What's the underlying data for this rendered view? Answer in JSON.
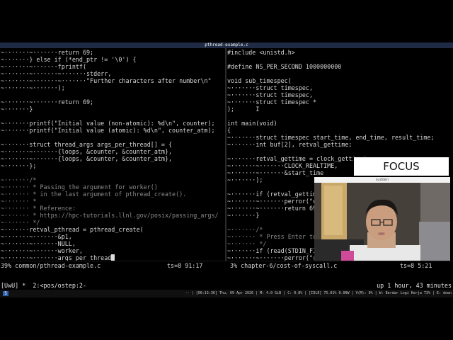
{
  "window": {
    "title": "pthread-example.c"
  },
  "left_pane": {
    "lines": [
      "~·······~·······return 69;",
      "~·······} else if (*end_ptr != '\\0') {",
      "~·······~·······fprintf(",
      "~·······~·······~·······stderr,",
      "~·······~·······~·······\"Further characters after number\\n\"",
      "~·······~·······);",
      "",
      "~·······~·······return 69;",
      "~·······}",
      "",
      "~·······printf(\"Initial value (non-atomic): %d\\n\", counter);",
      "~·······printf(\"Initial value (atomic): %d\\n\", counter_atm);",
      "",
      "~·······struct thread_args args_per_thread[] = {",
      "~·······~·······{loops, &counter, &counter_atm},",
      "~·······~·······{loops, &counter, &counter_atm},",
      "~·······};",
      "",
      "~·······/*",
      "~······· * Passing the argument for worker()",
      "~······· * in the last argument of pthread_create().",
      "~······· *",
      "~······· * Reference:",
      "~······· * https://hpc-tutorials.llnl.gov/posix/passing_args/",
      "~······· */",
      "~·······retval_pthread = pthread_create(",
      "~·······~·······&p1,",
      "~·······~·······NULL,",
      "~·······~·······worker,",
      "~·······~·······args_per_thread"
    ],
    "status_left": "39% common/pthread-example.c",
    "status_right": "ts=8 91:17"
  },
  "right_pane": {
    "lines": [
      "#include <unistd.h>",
      "",
      "#define NS_PER_SECOND 1000000000",
      "",
      "void sub_timespec(",
      "~·······struct timespec,",
      "~·······struct timespec,",
      "~·······struct timespec *",
      ");      I",
      "",
      "int main(void)",
      "{",
      "~·······struct timespec start_time, end_time, result_time;",
      "~·······int buf[2], retval_gettime;",
      "",
      "~·······retval_gettime = clock_gettime(",
      "~·······~·······CLOCK_REALTIME,",
      "~·······~·······&start_time",
      "~·······);",
      "",
      "~·······if (retval_gettime",
      "~·······~·······perror(\"c",
      "~·······~·······return 69",
      "~·······}",
      "",
      "~·······/*",
      "~······· * Press Enter to",
      "~······· */",
      "~·······if (read(STDIN_FI",
      "~·······~·······perror(\"r"
    ],
    "status_left": "3% chapter-6/cost-of-syscall.c",
    "status_right": "ts=8 5:21"
  },
  "tmux": {
    "left": "[UwU] *  2:<pos/ostep:2-",
    "right": "up 1 hour, 43 minutes"
  },
  "sysbar": {
    "workspace": "5",
    "info": "-- | [06:13:36] Thu, 09 Apr 2026 | M: 4.0 GiB | C: 0.8% | [IDLE] 75.01% 0.00W | V(M): 0% | W: Berdar Logi Kerja 73% | E: down"
  },
  "overlay": {
    "focus_label": "FOCUS",
    "webcam_title": "sudden"
  },
  "colors": {
    "titlebar_bg": "#1f2a44",
    "string_color": "#e8d6a0",
    "comment_color": "#8a8a8a"
  }
}
